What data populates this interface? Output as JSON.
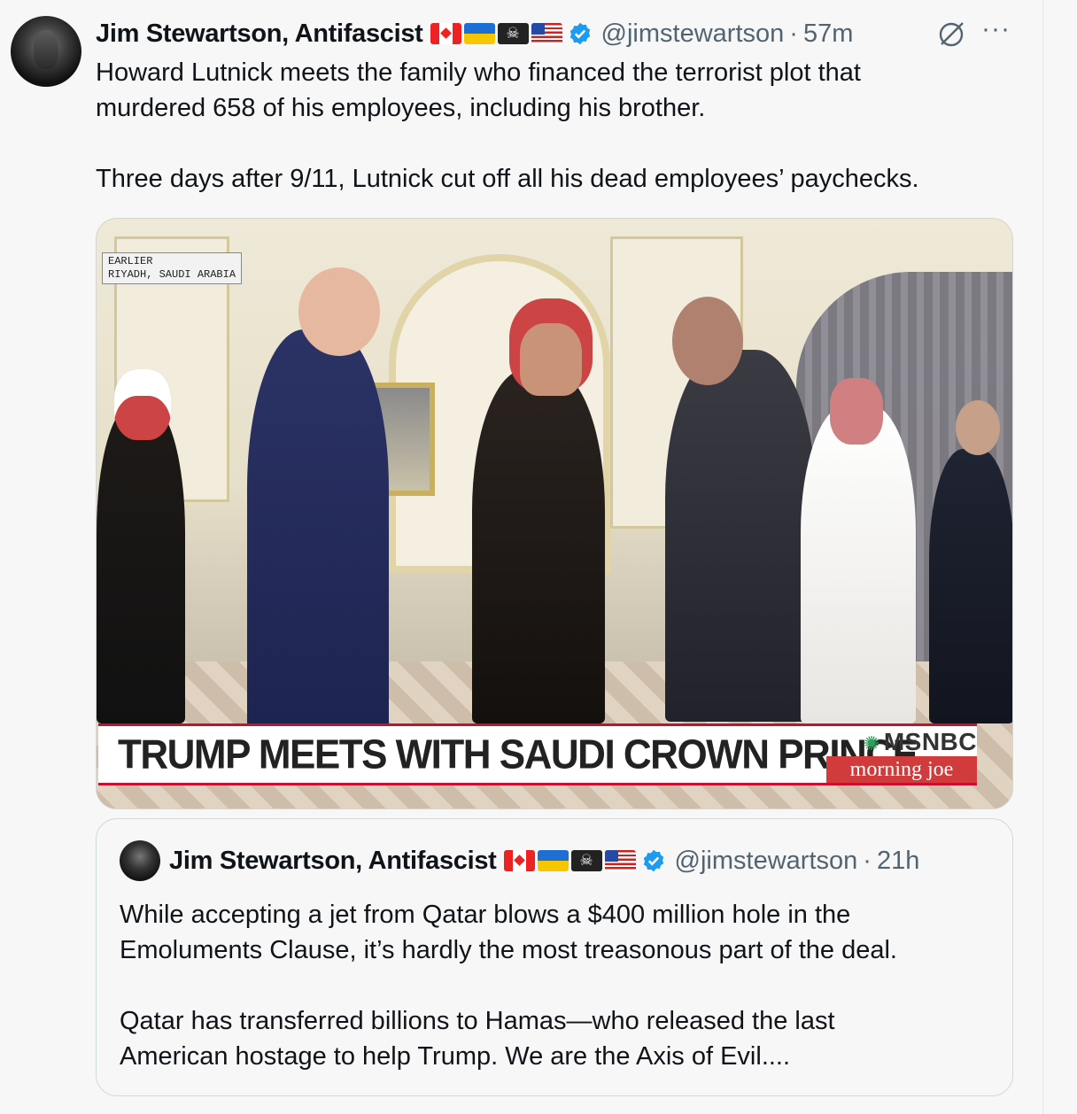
{
  "tweet": {
    "author_name": "Jim Stewartson, Antifascist",
    "flags": [
      "canada-flag",
      "ukraine-flag",
      "pirate-flag",
      "us-flag"
    ],
    "handle": "@jimstewartson",
    "separator": "·",
    "time": "57m",
    "more_label": "···",
    "text": "Howard Lutnick meets the family who financed the terrorist plot that\nmurdered 658 of his employees, including his brother.\n\nThree days after 9/11, Lutnick cut off all his dead employees’ paychecks."
  },
  "media": {
    "locator_line1": "EARLIER",
    "locator_line2": "RIYADH, SAUDI ARABIA",
    "chyron": "TRUMP MEETS WITH SAUDI CROWN PRINCE",
    "network": "MSNBC",
    "show": "morning joe"
  },
  "quote": {
    "author_name": "Jim Stewartson, Antifascist",
    "handle": "@jimstewartson",
    "separator": "·",
    "time": "21h",
    "text": "While accepting a jet from Qatar blows a $400 million hole in the\nEmoluments Clause, it’s hardly the most treasonous part of the deal.\n\nQatar has transferred billions to Hamas—who released the last\nAmerican hostage to help Trump. We are the Axis of Evil...."
  },
  "colors": {
    "verified_blue": "#1d9bf0",
    "secondary_text": "#536471",
    "chyron_red": "#c8102e"
  }
}
